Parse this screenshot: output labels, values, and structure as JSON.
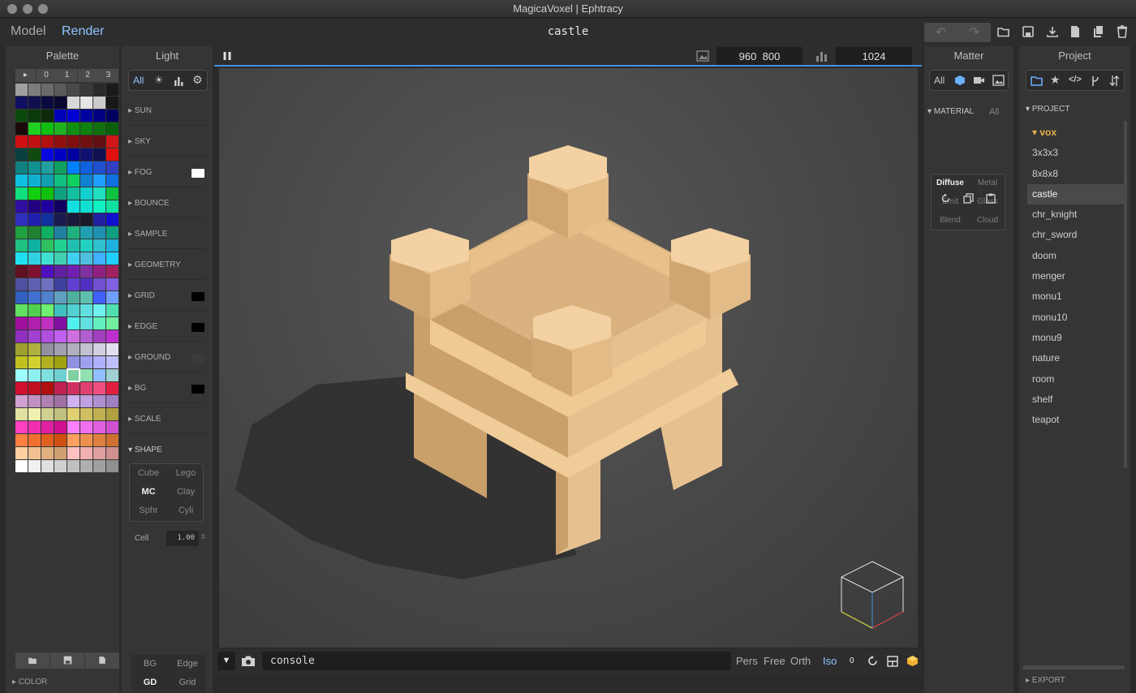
{
  "window": {
    "title": "MagicaVoxel | Ephtracy"
  },
  "menubar": {
    "model_tab": "Model",
    "render_tab": "Render",
    "document_name": "castle",
    "undo_icon": "↶",
    "redo_icon": "↷"
  },
  "palette": {
    "title": "Palette",
    "tabs": [
      "▸",
      "0",
      "1",
      "2",
      "3"
    ],
    "footer_section": "COLOR",
    "colors": [
      "#a0a0a0",
      "#7c7c7c",
      "#6a6a6a",
      "#5a5a5a",
      "#4a4a4a",
      "#3a3a3a",
      "#2a2a2a",
      "#1a1a1a",
      "#101060",
      "#101050",
      "#0a0a40",
      "#080830",
      "#d8d8d8",
      "#e6e6e6",
      "#cccccc",
      "#181818",
      "#0a4a0a",
      "#0a3a0a",
      "#0a2a0a",
      "#0000b8",
      "#0000d0",
      "#0000a0",
      "#000080",
      "#000060",
      "#1a0a0a",
      "#20d020",
      "#10c010",
      "#20b020",
      "#109010",
      "#108010",
      "#107010",
      "#0a600a",
      "#d01010",
      "#c01010",
      "#b01010",
      "#901010",
      "#801010",
      "#701010",
      "#601010",
      "#d01818",
      "#0a4040",
      "#104a10",
      "#0808e0",
      "#0000c0",
      "#0000a0",
      "#101070",
      "#101050",
      "#e01010",
      "#108080",
      "#109090",
      "#20a0a0",
      "#10a060",
      "#0080ff",
      "#1060e0",
      "#2050d0",
      "#3040c0",
      "#10c0e0",
      "#10b0d0",
      "#10a0b0",
      "#10c080",
      "#10d060",
      "#1080d0",
      "#20a0ff",
      "#1070e0",
      "#10e080",
      "#10d010",
      "#10c010",
      "#10a080",
      "#10c0a0",
      "#10d0d0",
      "#20e0c0",
      "#10c040",
      "#3010a0",
      "#200080",
      "#2000a0",
      "#100060",
      "#10e0e0",
      "#10e0d0",
      "#10f0c0",
      "#10e0a0",
      "#3030c0",
      "#2020b0",
      "#1030a0",
      "#1a1a50",
      "#1a1a3a",
      "#1a1a2a",
      "#2020a0",
      "#1010d0",
      "#20a040",
      "#208030",
      "#10b060",
      "#2080a0",
      "#20b080",
      "#20a0b0",
      "#2090b0",
      "#10a080",
      "#20c080",
      "#10b0a0",
      "#30c060",
      "#20d090",
      "#20c0b0",
      "#20d0c0",
      "#30c0d0",
      "#20b0e0",
      "#20e0f0",
      "#30d0e0",
      "#40e0d0",
      "#40d0b0",
      "#40d0f0",
      "#50c0e0",
      "#40b0ff",
      "#20d0ff",
      "#601020",
      "#801030",
      "#5010c0",
      "#6020a0",
      "#7020b0",
      "#8030a0",
      "#902080",
      "#a02060",
      "#5050a0",
      "#6060b0",
      "#7070c0",
      "#4040a0",
      "#6040d0",
      "#5030c0",
      "#7050d0",
      "#8060e0",
      "#3060c0",
      "#4070d0",
      "#5080d0",
      "#60a0c0",
      "#50b0a0",
      "#60c0b0",
      "#4060ff",
      "#70a0ff",
      "#60e060",
      "#50d050",
      "#70f070",
      "#40c0c0",
      "#50d0d0",
      "#60e0e0",
      "#70f0f0",
      "#50e0b0",
      "#a010a0",
      "#b020b0",
      "#c030c0",
      "#8010a0",
      "#50f0f0",
      "#60e0e0",
      "#60f0c0",
      "#70f0a0",
      "#9030c0",
      "#a040d0",
      "#b050e0",
      "#c060f0",
      "#d070e0",
      "#b060d0",
      "#a040c0",
      "#c030d0",
      "#a0a030",
      "#b0b040",
      "#9090a0",
      "#a0a0b0",
      "#b0b0c0",
      "#c0c0d0",
      "#d0d0e0",
      "#e0e0f0",
      "#c0c020",
      "#d0d030",
      "#b0b020",
      "#a0a010",
      "#9090e0",
      "#a0a0f0",
      "#b0b0ff",
      "#c0c0ff",
      "#a0ffff",
      "#90f0f0",
      "#80e0e0",
      "#70d0d0",
      "#80d0a0",
      "#90e0b0",
      "#90c0ff",
      "#a0d0d0",
      "#d01030",
      "#c01020",
      "#b01010",
      "#c02050",
      "#d03060",
      "#e04070",
      "#f05080",
      "#e02040",
      "#d0a0d0",
      "#c090c0",
      "#b080b0",
      "#a070a0",
      "#d0b0f0",
      "#c0a0e0",
      "#b090d0",
      "#a080c0",
      "#e0e0a0",
      "#f0f0b0",
      "#d0d090",
      "#c0c080",
      "#e0d070",
      "#d0c060",
      "#c0b050",
      "#b0a040",
      "#ff40c0",
      "#f030b0",
      "#e020a0",
      "#d01090",
      "#ff80ff",
      "#f070f0",
      "#e060e0",
      "#d050d0",
      "#ff8040",
      "#f07030",
      "#e06020",
      "#d05010",
      "#ffa060",
      "#f09050",
      "#e08040",
      "#d07030",
      "#ffd0a0",
      "#f0c090",
      "#e0b080",
      "#d0a070",
      "#ffc0c0",
      "#f0b0b0",
      "#e0a0a0",
      "#d09090",
      "#ffffff",
      "#f0f0f0",
      "#e0e0e0",
      "#d0d0d0",
      "#c0c0c0",
      "#b0b0b0",
      "#a0a0a0",
      "#909090"
    ]
  },
  "light": {
    "title": "Light",
    "filter_all": "All",
    "sections": [
      {
        "label": "SUN",
        "swatch": ""
      },
      {
        "label": "SKY",
        "swatch": ""
      },
      {
        "label": "FOG",
        "swatch": "#ffffff"
      },
      {
        "label": "BOUNCE",
        "swatch": ""
      },
      {
        "label": "SAMPLE",
        "swatch": ""
      },
      {
        "label": "GEOMETRY",
        "swatch": ""
      },
      {
        "label": "GRID",
        "swatch": "#000000"
      },
      {
        "label": "EDGE",
        "swatch": "#000000"
      },
      {
        "label": "GROUND",
        "swatch": "#3a3a3a"
      },
      {
        "label": "BG",
        "swatch": "#000000"
      },
      {
        "label": "SCALE",
        "swatch": ""
      }
    ],
    "shape": {
      "label": "SHAPE",
      "options": [
        "Cube",
        "Lego",
        "MC",
        "Clay",
        "Sphr",
        "Cyli"
      ],
      "selected": "MC",
      "cell_label": "Cell",
      "cell_value": "1.00"
    },
    "footer": {
      "bg": "BG",
      "edge": "Edge",
      "gd": "GD",
      "grid": "Grid"
    }
  },
  "viewport": {
    "width_value": "960",
    "height_value": "800",
    "sample_count": "1024",
    "console_text": "console",
    "camera_modes": [
      "Pers",
      "Free",
      "Orth",
      "Iso"
    ],
    "active_camera": "Iso",
    "zoom_value": "0",
    "colors": {
      "voxel": "#e8c08a",
      "shadow": "#303030",
      "accent": "#4a8fdc"
    }
  },
  "matter": {
    "title": "Matter",
    "filter_all": "All",
    "material_label": "MATERIAL",
    "material_filter": "All",
    "types": [
      "Diffuse",
      "Metal",
      "Emit",
      "Glass",
      "Blend",
      "Cloud"
    ],
    "selected": "Diffuse"
  },
  "project": {
    "title": "Project",
    "section": "PROJECT",
    "folder": "vox",
    "items": [
      "3x3x3",
      "8x8x8",
      "castle",
      "chr_knight",
      "chr_sword",
      "doom",
      "menger",
      "monu1",
      "monu10",
      "monu9",
      "nature",
      "room",
      "shelf",
      "teapot"
    ],
    "selected": "castle",
    "export_label": "EXPORT"
  }
}
